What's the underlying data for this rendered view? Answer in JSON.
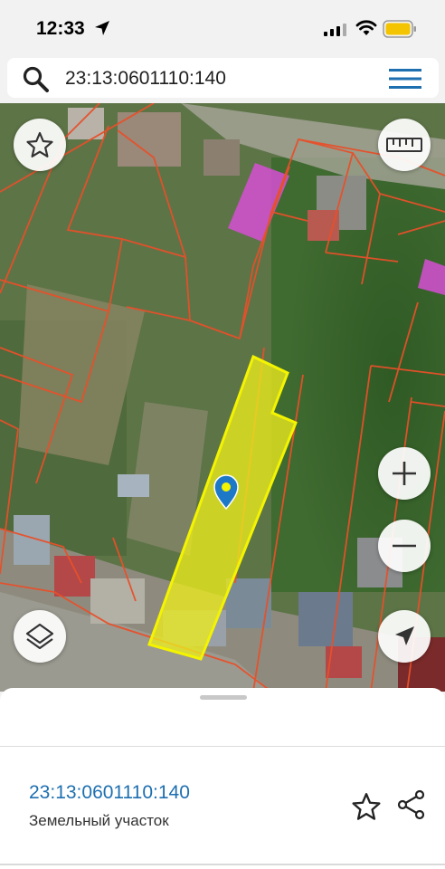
{
  "status_bar": {
    "time": "12:33"
  },
  "search": {
    "query": "23:13:0601110:140"
  },
  "map_controls": {
    "favorite": "star-icon",
    "ruler": "ruler-icon",
    "zoom_in": "plus-icon",
    "zoom_out": "minus-icon",
    "layers": "layers-icon",
    "locate": "navigation-arrow-icon"
  },
  "colors": {
    "parcel_fill": "#ecec1e",
    "parcel_border": "#f4f400",
    "boundary_lines": "#e8502a",
    "building_highlight": "#d64fd4",
    "marker": "#1e78c8",
    "accent_text": "#1e6fb0"
  },
  "sheet": {
    "parcel_id": "23:13:0601110:140",
    "parcel_type": "Земельный участок"
  }
}
